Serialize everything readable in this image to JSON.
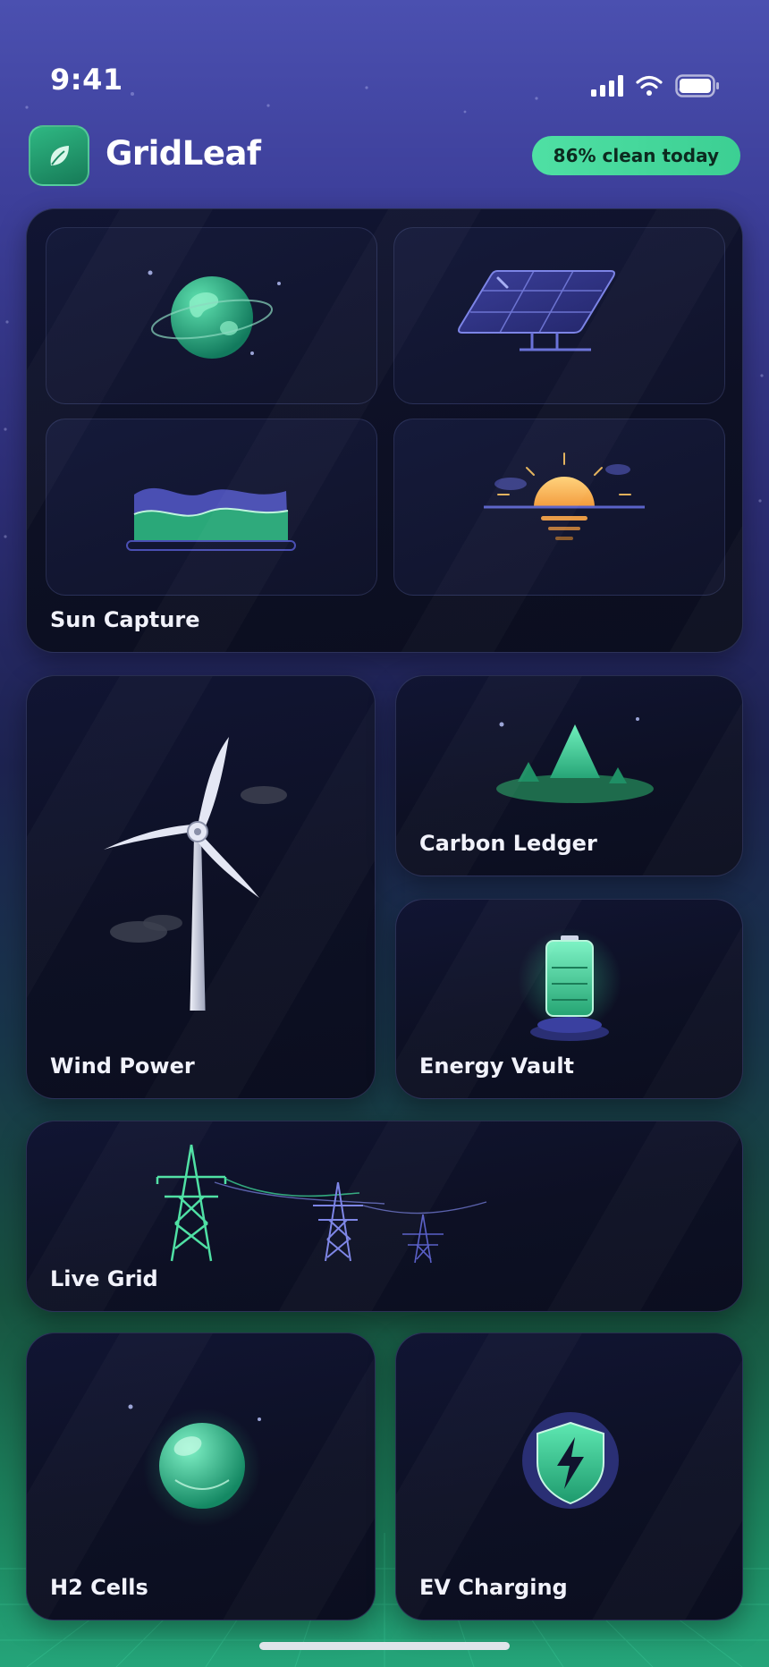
{
  "status_bar": {
    "time": "9:41"
  },
  "app": {
    "name": "GridLeaf",
    "clean_badge": "86% clean today"
  },
  "colors": {
    "accent": "#3ccf93",
    "indigo": "#5a60c8",
    "card_bg": "#0d1024"
  },
  "cards": {
    "sun_capture": {
      "label": "Sun Capture"
    },
    "wind_power": {
      "label": "Wind Power"
    },
    "carbon_ledger": {
      "label": "Carbon Ledger"
    },
    "energy_vault": {
      "label": "Energy Vault"
    },
    "live_grid": {
      "label": "Live Grid"
    },
    "h2_cells": {
      "label": "H2 Cells"
    },
    "ev_charging": {
      "label": "EV Charging"
    }
  }
}
